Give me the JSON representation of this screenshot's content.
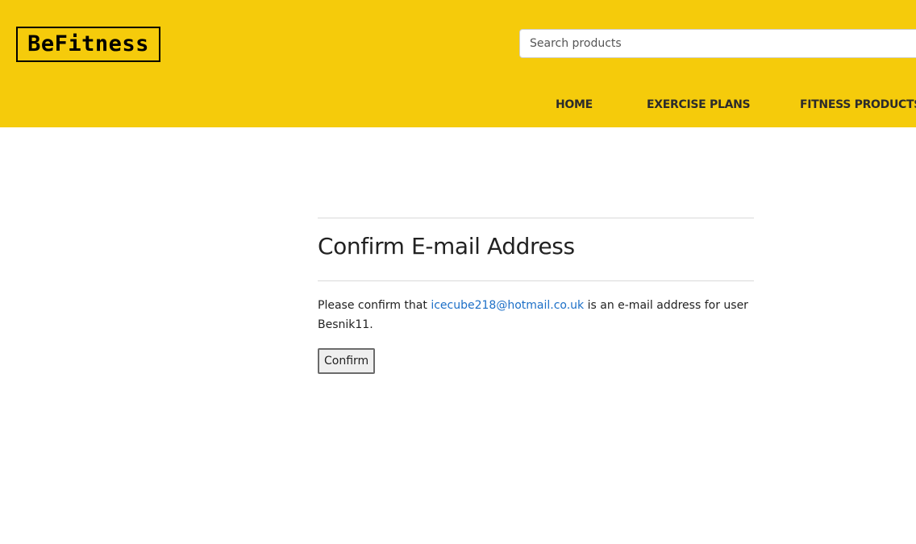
{
  "header": {
    "logo_text": "BeFitness",
    "search_placeholder": "Search products",
    "nav": {
      "home": "HOME",
      "exercise_plans": "EXERCISE PLANS",
      "fitness_products": "FITNESS PRODUCTS"
    },
    "background_color": "#f5cb0b"
  },
  "main": {
    "title": "Confirm E-mail Address",
    "message_prefix": "Please confirm that ",
    "email": "icecube218@hotmail.co.uk",
    "message_suffix": " is an e-mail address for user Besnik11.",
    "confirm_label": "Confirm",
    "link_color": "#1c6fc7"
  }
}
